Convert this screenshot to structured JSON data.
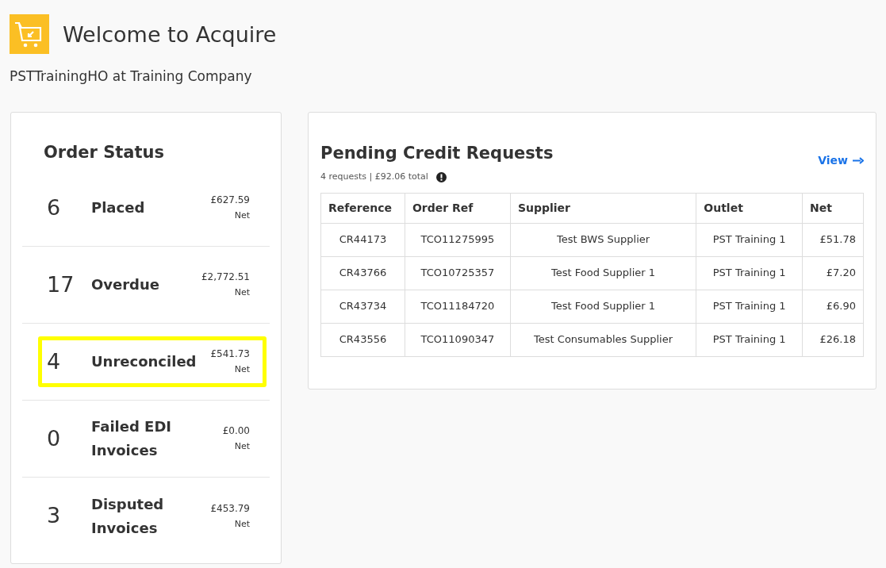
{
  "header": {
    "title": "Welcome to Acquire",
    "subtitle": "PSTTrainingHO at Training Company"
  },
  "order_status": {
    "title": "Order Status",
    "items": [
      {
        "count": "6",
        "label": "Placed",
        "amount": "£627.59",
        "note": "Net",
        "highlighted": false
      },
      {
        "count": "17",
        "label": "Overdue",
        "amount": "£2,772.51",
        "note": "Net",
        "highlighted": false
      },
      {
        "count": "4",
        "label": "Unreconciled",
        "amount": "£541.73",
        "note": "Net",
        "highlighted": true
      },
      {
        "count": "0",
        "label": "Failed EDI Invoices",
        "amount": "£0.00",
        "note": "Net",
        "highlighted": false
      },
      {
        "count": "3",
        "label": "Disputed Invoices",
        "amount": "£453.79",
        "note": "Net",
        "highlighted": false
      }
    ]
  },
  "pending_credit_requests": {
    "title": "Pending Credit Requests",
    "summary": "4 requests | £92.06 total",
    "view_link": "View",
    "table": {
      "columns": [
        "Reference",
        "Order Ref",
        "Supplier",
        "Outlet",
        "Net"
      ],
      "rows": [
        [
          "CR44173",
          "TCO11275995",
          "Test BWS Supplier",
          "PST Training 1",
          "£51.78"
        ],
        [
          "CR43766",
          "TCO10725357",
          "Test Food Supplier 1",
          "PST Training 1",
          "£7.20"
        ],
        [
          "CR43734",
          "TCO11184720",
          "Test Food Supplier 1",
          "PST Training 1",
          "£6.90"
        ],
        [
          "CR43556",
          "TCO11090347",
          "Test Consumables Supplier",
          "PST Training 1",
          "£26.18"
        ]
      ]
    }
  }
}
